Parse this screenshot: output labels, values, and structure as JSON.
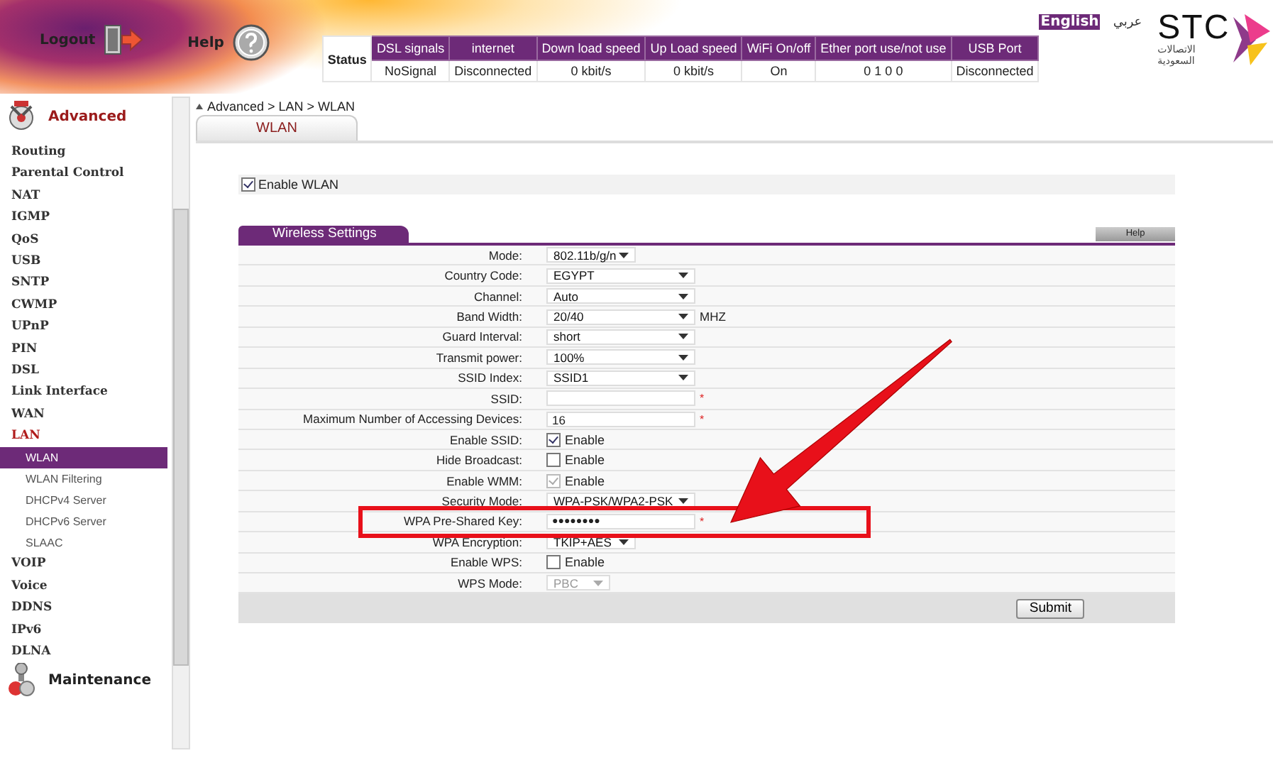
{
  "header": {
    "logout": "Logout",
    "help": "Help"
  },
  "status": {
    "title": "Status",
    "columns": [
      {
        "heading": "DSL signals",
        "value": "NoSignal"
      },
      {
        "heading": "internet",
        "value": "Disconnected"
      },
      {
        "heading": "Down load speed",
        "value": "0 kbit/s"
      },
      {
        "heading": "Up Load speed",
        "value": "0 kbit/s"
      },
      {
        "heading": "WiFi On/off",
        "value": "On"
      },
      {
        "heading": "Ether port use/not use",
        "value": "0 1 0 0"
      },
      {
        "heading": "USB Port",
        "value": "Disconnected"
      }
    ]
  },
  "languages": [
    {
      "label": "English",
      "selected": true
    },
    {
      "label": "عربي",
      "selected": false
    }
  ],
  "logo": {
    "name": "STC",
    "subtitle": "الاتصالات السعودية"
  },
  "sidebar": {
    "sections": [
      {
        "label": "Advanced",
        "kind": "advanced",
        "items": [
          {
            "label": "Routing",
            "expanded": false
          },
          {
            "label": "Parental Control",
            "expanded": false
          },
          {
            "label": "NAT",
            "expanded": false
          },
          {
            "label": "IGMP",
            "expanded": false
          },
          {
            "label": "QoS",
            "expanded": false
          },
          {
            "label": "USB",
            "expanded": false
          },
          {
            "label": "SNTP",
            "expanded": false
          },
          {
            "label": "CWMP",
            "expanded": false
          },
          {
            "label": "UPnP",
            "expanded": false
          },
          {
            "label": "PIN",
            "expanded": false
          },
          {
            "label": "DSL",
            "expanded": false
          },
          {
            "label": "Link Interface",
            "expanded": false
          },
          {
            "label": "WAN",
            "expanded": false
          },
          {
            "label": "LAN",
            "expanded": true,
            "children": [
              {
                "label": "WLAN",
                "selected": true
              },
              {
                "label": "WLAN Filtering",
                "selected": false
              },
              {
                "label": "DHCPv4 Server",
                "selected": false
              },
              {
                "label": "DHCPv6 Server",
                "selected": false
              },
              {
                "label": "SLAAC",
                "selected": false
              }
            ]
          },
          {
            "label": "VOIP",
            "expanded": false
          },
          {
            "label": "Voice",
            "expanded": false
          },
          {
            "label": "DDNS",
            "expanded": false
          },
          {
            "label": "IPv6",
            "expanded": false
          },
          {
            "label": "DLNA",
            "expanded": false
          }
        ]
      },
      {
        "label": "Maintenance",
        "kind": "maintenance"
      }
    ]
  },
  "breadcrumb": "Advanced > LAN > WLAN",
  "tabs": [
    {
      "label": "WLAN",
      "selected": true
    }
  ],
  "enable_wlan": {
    "label": "Enable WLAN",
    "checked": true
  },
  "section": {
    "title": "Wireless Settings",
    "help": "Help"
  },
  "fields": [
    {
      "label": "Mode:",
      "kind": "small_select",
      "value": "802.11b/g/n",
      "disabled": false
    },
    {
      "label": "Country Code:",
      "kind": "select",
      "value": "EGYPT",
      "disabled": false
    },
    {
      "label": "Channel:",
      "kind": "select",
      "value": "Auto",
      "disabled": false
    },
    {
      "label": "Band Width:",
      "kind": "select",
      "value": "20/40",
      "unit": "MHZ",
      "disabled": false
    },
    {
      "label": "Guard Interval:",
      "kind": "select",
      "value": "short",
      "disabled": false
    },
    {
      "label": "Transmit power:",
      "kind": "select",
      "value": "100%",
      "disabled": false
    },
    {
      "label": "SSID Index:",
      "kind": "select",
      "value": "SSID1",
      "disabled": false
    },
    {
      "label": "SSID:",
      "kind": "input",
      "required": "*"
    },
    {
      "label": "Maximum Number of Accessing Devices:",
      "kind": "input",
      "value": "16",
      "required": "*"
    },
    {
      "label": "Enable SSID:",
      "kind": "checkbox",
      "text": "Enable",
      "checked": true,
      "disabled": false
    },
    {
      "label": "Hide Broadcast:",
      "kind": "checkbox",
      "text": "Enable",
      "checked": false,
      "disabled": false
    },
    {
      "label": "Enable WMM:",
      "kind": "checkbox",
      "text": "Enable",
      "checked": true,
      "disabled": true
    },
    {
      "label": "Security Mode:",
      "kind": "select",
      "value": "WPA-PSK/WPA2-PSK",
      "disabled": false
    },
    {
      "label": "WPA Pre-Shared Key:",
      "kind": "password",
      "value": "●●●●●●●●",
      "required": "*"
    },
    {
      "label": "WPA Encryption:",
      "kind": "small_select",
      "value": "TKIP+AES",
      "disabled": false
    },
    {
      "label": "Enable WPS:",
      "kind": "checkbox",
      "text": "Enable",
      "checked": false,
      "disabled": false
    },
    {
      "label": "WPS Mode:",
      "kind": "tiny_select",
      "value": "PBC",
      "disabled": true
    }
  ],
  "submit": "Submit"
}
